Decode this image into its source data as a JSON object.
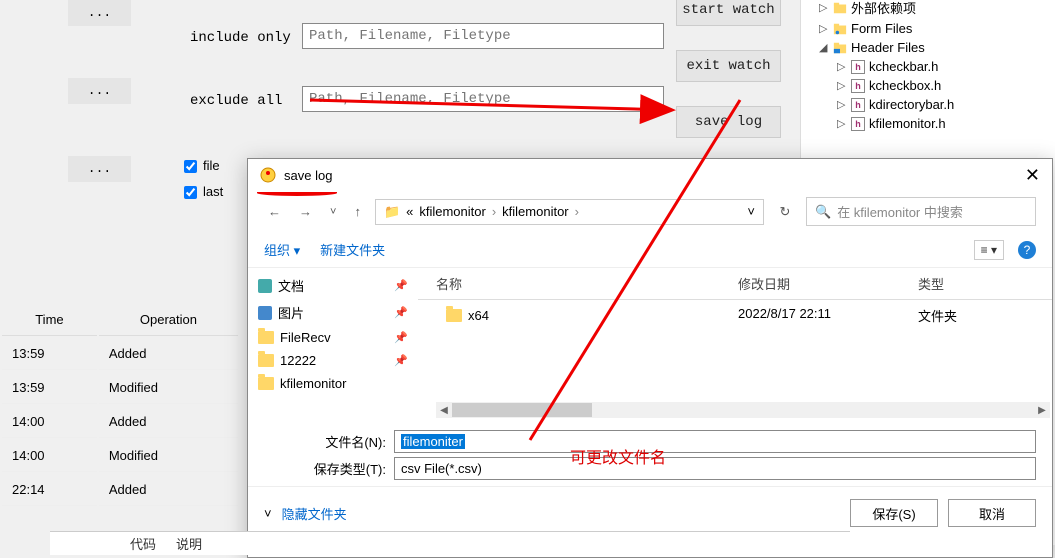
{
  "filters": {
    "include_label": "include only",
    "include_placeholder": "Path, Filename, Filetype",
    "exclude_label": "exclude  all",
    "exclude_placeholder": "Path, Filename, Filetype"
  },
  "side_buttons": {
    "start": "start watch",
    "exit": "exit watch",
    "save": "save log"
  },
  "checks": {
    "file": "file",
    "last": "last"
  },
  "table": {
    "headers": {
      "time": "Time",
      "op": "Operation"
    },
    "rows": [
      {
        "time": "13:59",
        "op": "Added"
      },
      {
        "time": "13:59",
        "op": "Modified"
      },
      {
        "time": "14:00",
        "op": "Added"
      },
      {
        "time": "14:00",
        "op": "Modified"
      },
      {
        "time": "22:14",
        "op": "Added"
      }
    ]
  },
  "tree": {
    "ext_deps": "外部依赖项",
    "form": "Form Files",
    "header": "Header Files",
    "files": [
      "kcheckbar.h",
      "kcheckbox.h",
      "kdirectorybar.h",
      "kfilemonitor.h"
    ]
  },
  "dialog": {
    "title": "save log",
    "crumb1": "kfilemonitor",
    "crumb2": "kfilemonitor",
    "search_ph": "在 kfilemonitor 中搜索",
    "organize": "组织",
    "new_folder": "新建文件夹",
    "quick": {
      "docs": "文档",
      "pics": "图片",
      "recv": "FileRecv",
      "n": "12222",
      "km": "kfilemonitor"
    },
    "cols": {
      "name": "名称",
      "date": "修改日期",
      "type": "类型"
    },
    "item": {
      "name": "x64",
      "date": "2022/8/17 22:11",
      "type": "文件夹"
    },
    "fn_label": "文件名(N):",
    "fn_value": "filemoniter",
    "ft_label": "保存类型(T):",
    "ft_value": "csv File(*.csv)",
    "hide": "隐藏文件夹",
    "save_btn": "保存(S)",
    "cancel_btn": "取消"
  },
  "annotation": "可更改文件名",
  "bottom": {
    "code": "代码",
    "desc": "说明"
  }
}
